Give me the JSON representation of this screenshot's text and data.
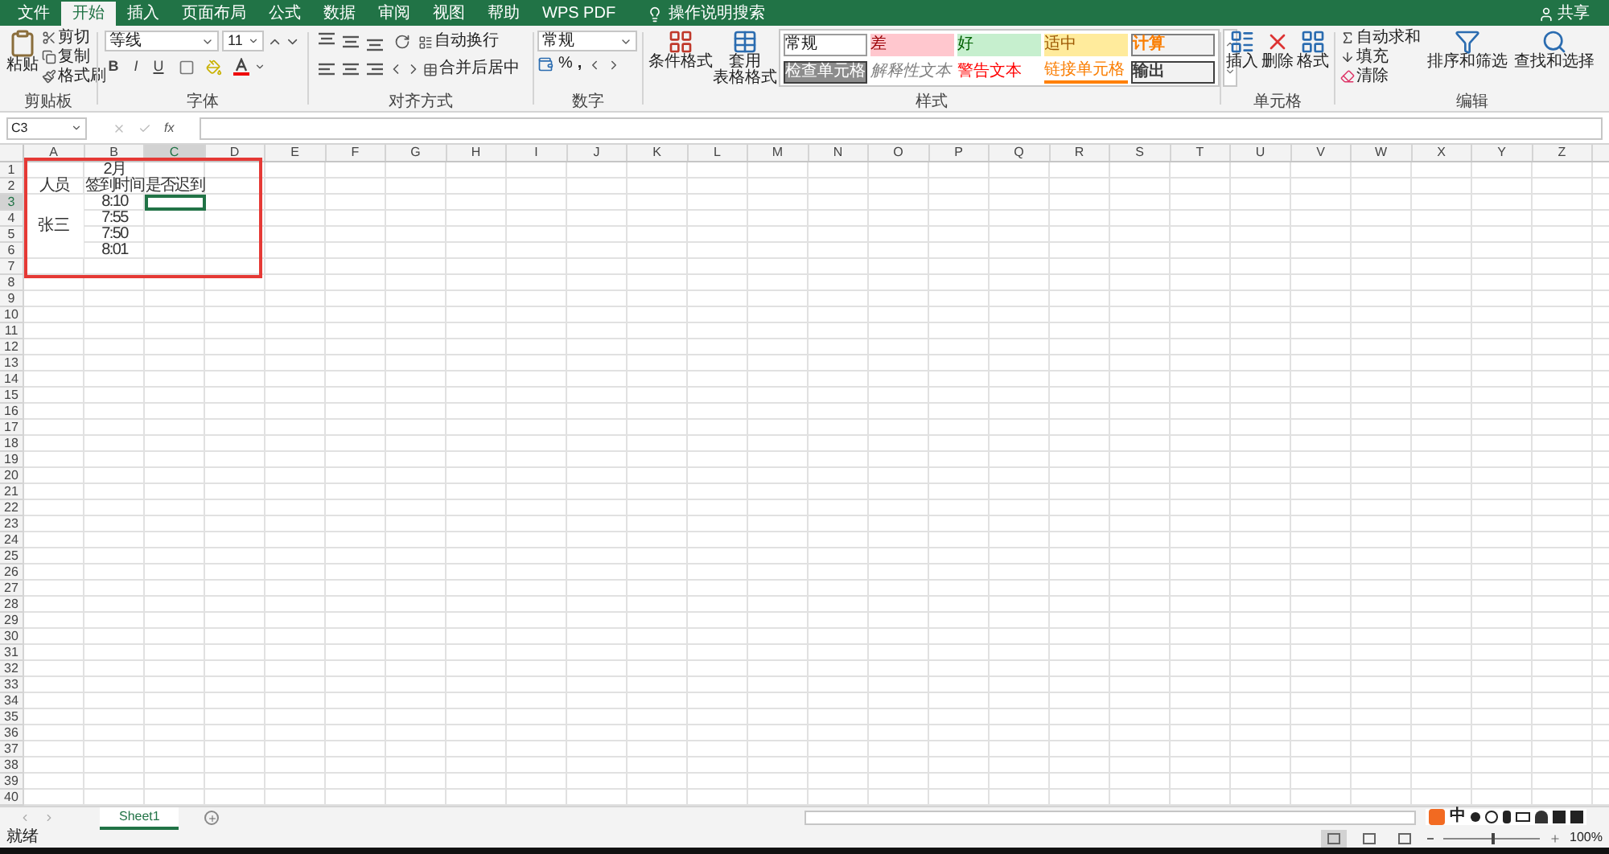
{
  "tabs": [
    {
      "label": "文件",
      "selected": false
    },
    {
      "label": "开始",
      "selected": true
    },
    {
      "label": "插入",
      "selected": false
    },
    {
      "label": "页面布局",
      "selected": false
    },
    {
      "label": "公式",
      "selected": false
    },
    {
      "label": "数据",
      "selected": false
    },
    {
      "label": "审阅",
      "selected": false
    },
    {
      "label": "视图",
      "selected": false
    },
    {
      "label": "帮助",
      "selected": false
    },
    {
      "label": "WPS PDF",
      "selected": false
    }
  ],
  "search_hint": "操作说明搜索",
  "share": "共享",
  "clipboard": {
    "label": "剪贴板",
    "paste": "粘贴",
    "items": [
      "剪切",
      "复制",
      "格式刷"
    ]
  },
  "font": {
    "label": "字体",
    "font_name": "等线",
    "font_size": "11",
    "styles": [
      "B",
      "I",
      "U"
    ]
  },
  "alignment": {
    "label": "对齐方式",
    "wrap": "自动换行",
    "merge": "合并后居中"
  },
  "number": {
    "label": "数字",
    "format": "常规",
    "percent": "%",
    "comma": ","
  },
  "styles": {
    "label": "样式",
    "conditional": "条件格式",
    "table_format": [
      "套用",
      "表格格式"
    ],
    "cells": [
      {
        "text": "常规",
        "kind": "normal"
      },
      {
        "text": "检查单元格",
        "kind": "check"
      },
      {
        "text": "差",
        "kind": "bad"
      },
      {
        "text": "解释性文本",
        "kind": "explanatory"
      },
      {
        "text": "好",
        "kind": "good"
      },
      {
        "text": "警告文本",
        "kind": "warning"
      },
      {
        "text": "适中",
        "kind": "neutral"
      },
      {
        "text": "链接单元格",
        "kind": "linked"
      },
      {
        "text": "计算",
        "kind": "calculation"
      },
      {
        "text": "输出",
        "kind": "output"
      }
    ]
  },
  "cells_group": {
    "label": "单元格",
    "buttons": [
      "插入",
      "删除",
      "格式"
    ]
  },
  "editing": {
    "label": "编辑",
    "small": [
      "自动求和",
      "填充",
      "清除"
    ],
    "sort": "排序和筛选",
    "find": "查找和选择"
  },
  "formula_bar": {
    "name_box": "C3",
    "fx": "fx"
  },
  "columns": [
    {
      "label": "A",
      "selected": false
    },
    {
      "label": "B",
      "selected": false
    },
    {
      "label": "C",
      "selected": true
    },
    {
      "label": "D",
      "selected": false
    },
    {
      "label": "E",
      "selected": false
    },
    {
      "label": "F",
      "selected": false
    },
    {
      "label": "G",
      "selected": false
    },
    {
      "label": "H",
      "selected": false
    },
    {
      "label": "I",
      "selected": false
    },
    {
      "label": "J",
      "selected": false
    },
    {
      "label": "K",
      "selected": false
    },
    {
      "label": "L",
      "selected": false
    },
    {
      "label": "M",
      "selected": false
    },
    {
      "label": "N",
      "selected": false
    },
    {
      "label": "O",
      "selected": false
    },
    {
      "label": "P",
      "selected": false
    },
    {
      "label": "Q",
      "selected": false
    },
    {
      "label": "R",
      "selected": false
    },
    {
      "label": "S",
      "selected": false
    },
    {
      "label": "T",
      "selected": false
    },
    {
      "label": "U",
      "selected": false
    },
    {
      "label": "V",
      "selected": false
    },
    {
      "label": "W",
      "selected": false
    },
    {
      "label": "X",
      "selected": false
    },
    {
      "label": "Y",
      "selected": false
    },
    {
      "label": "Z",
      "selected": false
    }
  ],
  "rows": [
    {
      "label": "1",
      "selected": false,
      "b": "2月"
    },
    {
      "label": "2",
      "selected": false,
      "a": "人员",
      "b": "签到时间",
      "c": "是否迟到"
    },
    {
      "label": "3",
      "selected": true,
      "b": "8:10"
    },
    {
      "label": "4",
      "selected": false,
      "b": "7:55"
    },
    {
      "label": "5",
      "selected": false,
      "b": "7:50"
    },
    {
      "label": "6",
      "selected": false,
      "b": "8:01"
    },
    {
      "label": "7",
      "selected": false
    },
    {
      "label": "8",
      "selected": false
    },
    {
      "label": "9",
      "selected": false
    },
    {
      "label": "10",
      "selected": false
    },
    {
      "label": "11",
      "selected": false
    },
    {
      "label": "12",
      "selected": false
    },
    {
      "label": "13",
      "selected": false
    },
    {
      "label": "14",
      "selected": false
    },
    {
      "label": "15",
      "selected": false
    },
    {
      "label": "16",
      "selected": false
    },
    {
      "label": "17",
      "selected": false
    },
    {
      "label": "18",
      "selected": false
    },
    {
      "label": "19",
      "selected": false
    },
    {
      "label": "20",
      "selected": false
    },
    {
      "label": "21",
      "selected": false
    },
    {
      "label": "22",
      "selected": false
    },
    {
      "label": "23",
      "selected": false
    },
    {
      "label": "24",
      "selected": false
    },
    {
      "label": "25",
      "selected": false
    },
    {
      "label": "26",
      "selected": false
    },
    {
      "label": "27",
      "selected": false
    },
    {
      "label": "28",
      "selected": false
    },
    {
      "label": "29",
      "selected": false
    },
    {
      "label": "30",
      "selected": false
    },
    {
      "label": "31",
      "selected": false
    },
    {
      "label": "32",
      "selected": false
    },
    {
      "label": "33",
      "selected": false
    },
    {
      "label": "34",
      "selected": false
    },
    {
      "label": "35",
      "selected": false
    },
    {
      "label": "36",
      "selected": false
    },
    {
      "label": "37",
      "selected": false
    },
    {
      "label": "38",
      "selected": false
    },
    {
      "label": "39",
      "selected": false
    },
    {
      "label": "40",
      "selected": false
    }
  ],
  "merged_cell": {
    "text": "张三"
  },
  "sheets": [
    {
      "label": "Sheet1",
      "selected": true
    }
  ],
  "ime": {
    "mode": "中"
  },
  "status_bar": {
    "text": "就绪",
    "zoom": "100%",
    "zoom_level": {
      "level": 0.5
    },
    "views": [
      {
        "selected": true
      },
      {
        "selected": false
      },
      {
        "selected": false
      }
    ]
  }
}
